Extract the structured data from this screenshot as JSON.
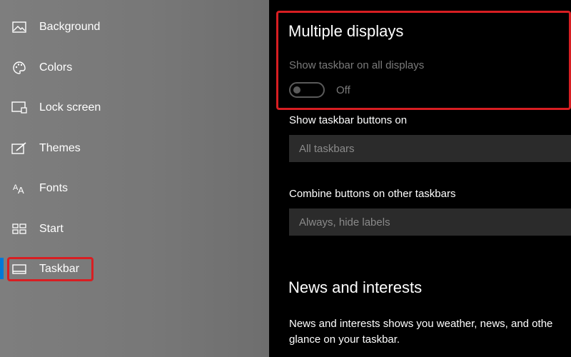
{
  "sidebar": {
    "items": [
      {
        "label": "Background",
        "icon": "picture-icon"
      },
      {
        "label": "Colors",
        "icon": "palette-icon"
      },
      {
        "label": "Lock screen",
        "icon": "lock-screen-icon"
      },
      {
        "label": "Themes",
        "icon": "themes-icon"
      },
      {
        "label": "Fonts",
        "icon": "fonts-icon"
      },
      {
        "label": "Start",
        "icon": "start-icon"
      },
      {
        "label": "Taskbar",
        "icon": "taskbar-icon",
        "selected": true
      }
    ]
  },
  "main": {
    "multiple_displays": {
      "heading": "Multiple displays",
      "show_all_label": "Show taskbar on all displays",
      "toggle_state": "Off"
    },
    "buttons_on": {
      "label": "Show taskbar buttons on",
      "value": "All taskbars"
    },
    "combine": {
      "label": "Combine buttons on other taskbars",
      "value": "Always, hide labels"
    },
    "news": {
      "heading": "News and interests",
      "line1": "News and interests shows you weather, news, and othe",
      "line2": "glance on your taskbar."
    }
  },
  "colors": {
    "accent": "#0078d7",
    "highlight": "#d81e22"
  }
}
